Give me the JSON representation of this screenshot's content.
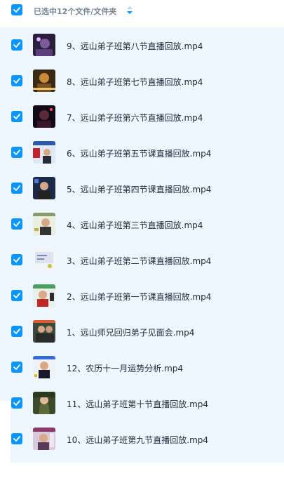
{
  "header": {
    "title": "已选中12个文件/文件夹",
    "sort_icon": "sort-arrows-icon",
    "checkbox_icon": "checkmark-icon"
  },
  "colors": {
    "accent": "#0a95ff",
    "list_bg": "#eef6ff",
    "text": "#1f2a3a",
    "header_text": "#7b8494"
  },
  "files": [
    {
      "name": "9、远山弟子班第八节直播回放.mp4",
      "checked": true
    },
    {
      "name": "8、远山弟子班第七节直播回放.mp4",
      "checked": true
    },
    {
      "name": "7、远山弟子班第六节直播回放.mp4",
      "checked": true
    },
    {
      "name": "6、远山弟子班第五节课直播回放.mp4",
      "checked": true
    },
    {
      "name": "5、远山弟子班第四节课直播回放.mp4",
      "checked": true
    },
    {
      "name": "4、远山弟子班第三节直播回放.mp4",
      "checked": true
    },
    {
      "name": "3、远山弟子班第二节课直播回放.mp4",
      "checked": true
    },
    {
      "name": "2、远山弟子班第一节课直播回放.mp4",
      "checked": true
    },
    {
      "name": "1、远山师兄回归弟子见面会.mp4",
      "checked": true
    },
    {
      "name": "12、农历十一月运势分析.mp4",
      "checked": true
    },
    {
      "name": "11、远山弟子班第十节直播回放.mp4",
      "checked": true
    },
    {
      "name": "10、远山弟子班第九节直播回放.mp4",
      "checked": true
    }
  ]
}
